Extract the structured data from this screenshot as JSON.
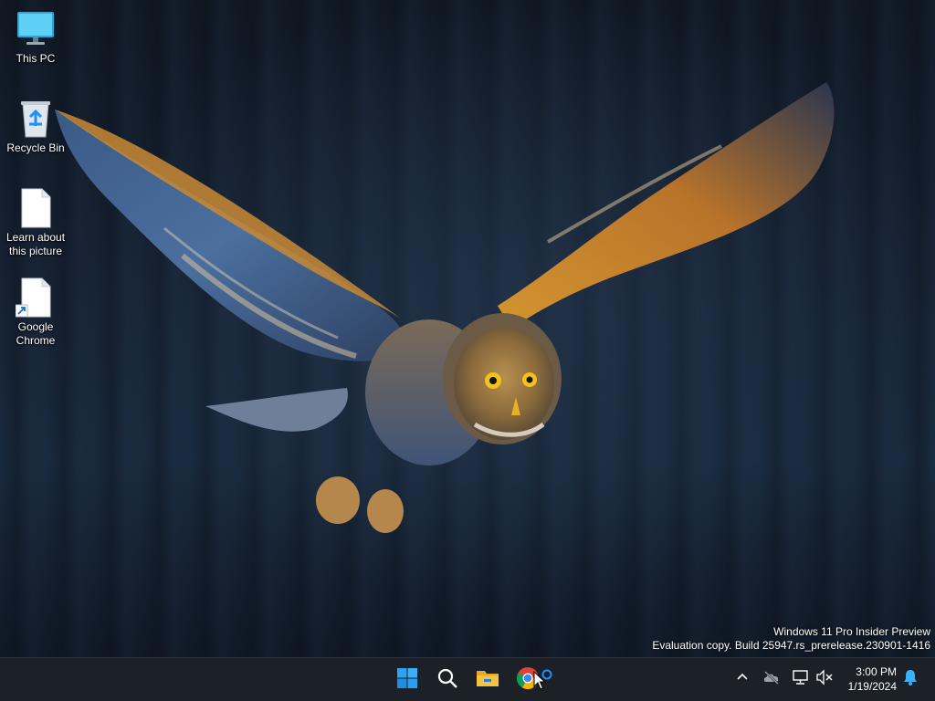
{
  "desktop": {
    "icons": [
      {
        "label": "This PC",
        "icon": "monitor-icon"
      },
      {
        "label": "Recycle Bin",
        "icon": "recycle-bin-icon"
      },
      {
        "label": "Learn about this picture",
        "icon": "document-icon"
      },
      {
        "label": "Google Chrome",
        "icon": "shortcut-document-icon"
      }
    ],
    "wallpaper": "owl in flight over dark forest"
  },
  "watermark": {
    "line1": "Windows 11 Pro Insider Preview",
    "line2": "Evaluation copy. Build 25947.rs_prerelease.230901-1416"
  },
  "taskbar": {
    "apps": [
      {
        "name": "start",
        "icon": "windows-logo-icon"
      },
      {
        "name": "search",
        "icon": "search-icon"
      },
      {
        "name": "file-explorer",
        "icon": "folder-icon"
      },
      {
        "name": "chrome",
        "icon": "chrome-icon"
      }
    ],
    "tray": {
      "icons": [
        "chevron-up-icon",
        "onedrive-offline-icon",
        "network-icon",
        "volume-muted-icon",
        "notification-bell-icon"
      ]
    },
    "clock": {
      "time": "3:00 PM",
      "date": "1/19/2024"
    }
  },
  "colors": {
    "taskbar_bg": "#1c2027",
    "accent_blue": "#1e90ff",
    "folder_yellow": "#f5c242"
  }
}
